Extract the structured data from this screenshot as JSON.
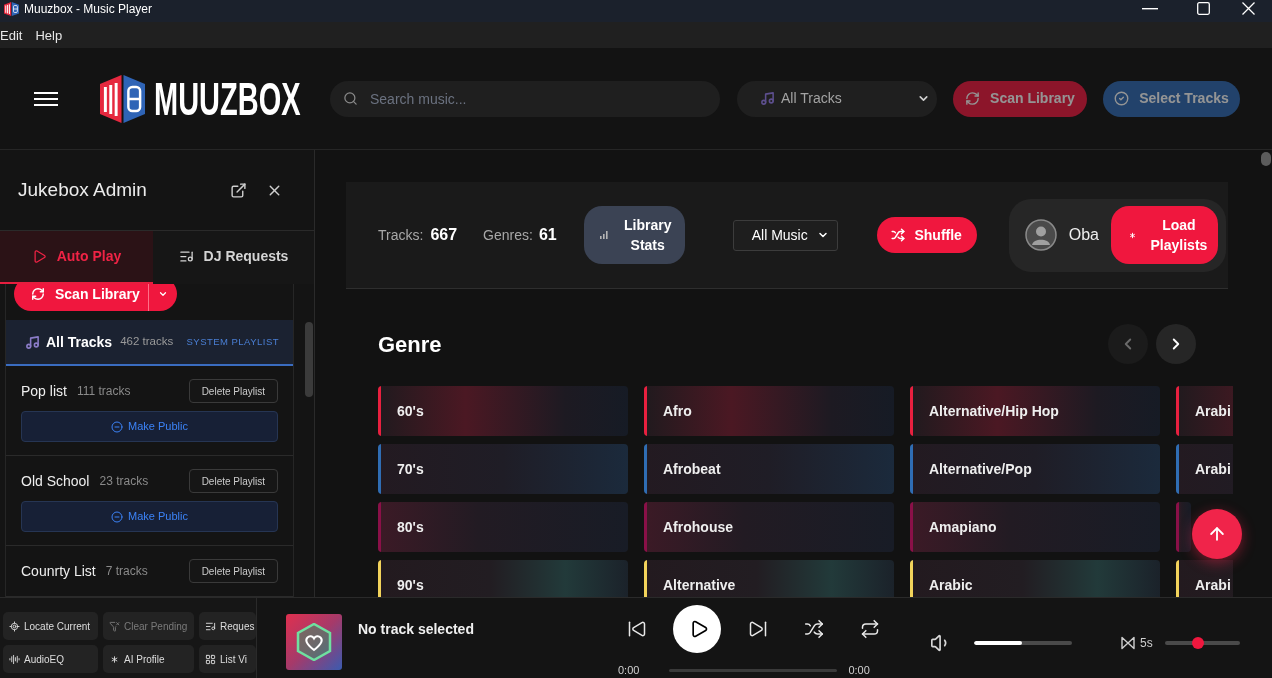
{
  "window": {
    "title": "Muuzbox - Music Player"
  },
  "menu_bar": [
    {
      "label": "Edit"
    },
    {
      "label": "Help"
    }
  ],
  "header": {
    "logo_text": "MUUZBOX",
    "search": {
      "placeholder": "Search music..."
    },
    "playlist_select": {
      "value": "All Tracks"
    },
    "actions": [
      {
        "label": "Scan Library",
        "kind": "scan",
        "disabled": true
      },
      {
        "label": "Select Tracks",
        "kind": "select",
        "disabled": true
      }
    ]
  },
  "sidebar": {
    "title": "Jukebox Admin",
    "tabs": [
      {
        "label": "Auto Play",
        "selected": true
      },
      {
        "label": "DJ Requests",
        "selected": false
      }
    ],
    "scan_button": {
      "label": "Scan Library"
    },
    "system_playlist": {
      "name": "All Tracks",
      "count": "462 tracks",
      "badge": "SYSTEM PLAYLIST"
    },
    "playlists": [
      {
        "name": "Pop list",
        "count": "111 tracks",
        "delete_label": "Delete Playlist",
        "public_label": "Make Public"
      },
      {
        "name": "Old School",
        "count": "23 tracks",
        "delete_label": "Delete Playlist",
        "public_label": "Make Public"
      },
      {
        "name": "Counrty List",
        "count": "7 tracks",
        "delete_label": "Delete Playlist"
      }
    ],
    "toolbar": [
      {
        "label": "Locate Current",
        "disabled": false
      },
      {
        "label": "Clear Pending",
        "disabled": true
      },
      {
        "label": "Reques",
        "disabled": false
      },
      {
        "label": "AudioEQ",
        "disabled": false
      },
      {
        "label": "AI Profile",
        "disabled": false
      },
      {
        "label": "List Vi",
        "disabled": false
      }
    ]
  },
  "stats_bar": {
    "tracks": {
      "label": "Tracks:",
      "value": "667"
    },
    "genres": {
      "label": "Genres:",
      "value": "61"
    },
    "library_stats_button": "Library Stats",
    "music_filter": {
      "value": "All Music"
    },
    "shuffle_button": "Shuffle",
    "user": {
      "name": "Oba"
    },
    "load_playlists_button": "Load Playlists"
  },
  "genre_section": {
    "title": "Genre",
    "prev_button": {
      "disabled": true
    },
    "next_button": {
      "disabled": false
    },
    "cards": [
      {
        "label": "60's",
        "color": "#e8203f"
      },
      {
        "label": "Afro",
        "color": "#e8203f"
      },
      {
        "label": "Alternative/Hip Hop",
        "color": "#e8203f"
      },
      {
        "label": "Arabi",
        "color": "#e8203f"
      },
      {
        "label": "70's",
        "color": "#2f6db3"
      },
      {
        "label": "Afrobeat",
        "color": "#2f6db3"
      },
      {
        "label": "Alternative/Pop",
        "color": "#2f6db3"
      },
      {
        "label": "Arabi",
        "color": "#2f6db3"
      },
      {
        "label": "80's",
        "color": "#8a1048"
      },
      {
        "label": "Afrohouse",
        "color": "#8a1048"
      },
      {
        "label": "Amapiano",
        "color": "#8a1048"
      },
      {
        "color": "#8a1048"
      },
      {
        "label": "90's",
        "color": "#f2d35b"
      },
      {
        "label": "Alternative",
        "color": "#f2d35b"
      },
      {
        "label": "Arabic",
        "color": "#f2d35b"
      },
      {
        "label": "Arabi",
        "color": "#f2d35b"
      }
    ]
  },
  "player": {
    "track_title": "No track selected",
    "playing": false,
    "elapsed": "0:00",
    "duration": "0:00",
    "volume": {
      "level": 0.49
    },
    "crossfade": {
      "reading": "5s",
      "level": 0.44
    }
  }
}
